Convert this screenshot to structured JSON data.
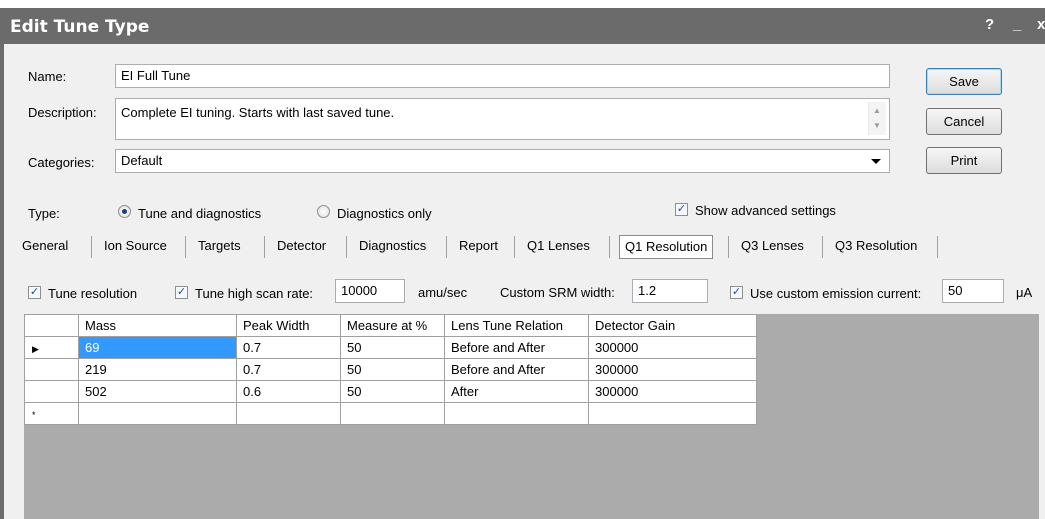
{
  "window": {
    "title": "Edit Tune Type",
    "help_label": "?",
    "minimize_label": "_",
    "close_label": "x"
  },
  "form": {
    "name_label": "Name:",
    "name_value": "EI Full Tune",
    "description_label": "Description:",
    "description_value": "Complete EI tuning. Starts with last saved tune.",
    "categories_label": "Categories:",
    "categories_value": "Default",
    "type_label": "Type:",
    "type_options": [
      {
        "label": "Tune and diagnostics",
        "selected": true
      },
      {
        "label": "Diagnostics only",
        "selected": false
      }
    ],
    "advanced_label": "Show advanced settings",
    "advanced_checked": true
  },
  "buttons": {
    "save": "Save",
    "cancel": "Cancel",
    "print": "Print"
  },
  "tabs": [
    {
      "label": "General"
    },
    {
      "label": "Ion Source"
    },
    {
      "label": "Targets"
    },
    {
      "label": "Detector"
    },
    {
      "label": "Diagnostics"
    },
    {
      "label": "Report"
    },
    {
      "label": "Q1 Lenses"
    },
    {
      "label": "Q1 Resolution",
      "selected": true
    },
    {
      "label": "Q3 Lenses"
    },
    {
      "label": "Q3 Resolution"
    }
  ],
  "options": {
    "tune_resolution_label": "Tune resolution",
    "tune_resolution_checked": true,
    "tune_high_scan_label": "Tune high scan rate:",
    "tune_high_scan_checked": true,
    "tune_high_scan_value": "10000",
    "tune_high_scan_unit": "amu/sec",
    "custom_srm_label": "Custom SRM width:",
    "custom_srm_value": "1.2",
    "custom_emission_label": "Use custom emission current:",
    "custom_emission_checked": true,
    "custom_emission_value": "50",
    "custom_emission_unit": "μA"
  },
  "grid": {
    "columns": [
      "Mass",
      "Peak Width",
      "Measure at %",
      "Lens Tune Relation",
      "Detector Gain"
    ],
    "rows": [
      [
        "69",
        "0.7",
        "50",
        "Before and After",
        "300000"
      ],
      [
        "219",
        "0.7",
        "50",
        "Before and After",
        "300000"
      ],
      [
        "502",
        "0.6",
        "50",
        "After",
        "300000"
      ]
    ],
    "current_row_marker": "▶",
    "new_row_marker": "*"
  }
}
